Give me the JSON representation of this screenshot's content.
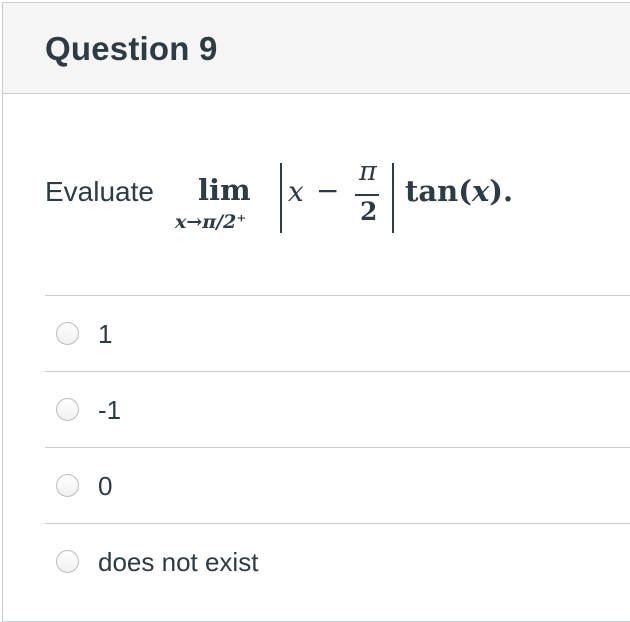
{
  "question": {
    "title": "Question 9",
    "prefix": "Evaluate",
    "math": {
      "lim": "lim",
      "lim_sub": "x→π/2⁺",
      "var": "x",
      "minus": "−",
      "numerator": "π",
      "denominator": "2",
      "tan": "tan(",
      "tan_arg": "x",
      "tan_close": ")."
    }
  },
  "answers": [
    {
      "label": "1"
    },
    {
      "label": "-1"
    },
    {
      "label": "0"
    },
    {
      "label": "does not exist"
    }
  ]
}
